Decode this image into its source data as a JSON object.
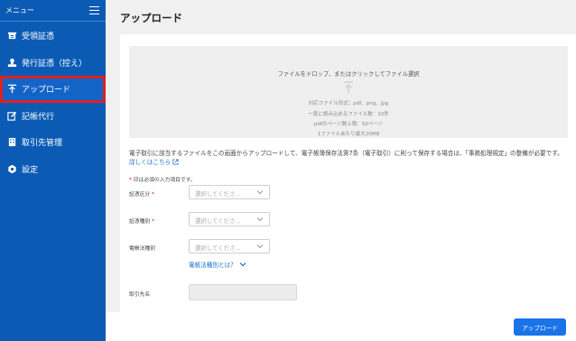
{
  "sidebar": {
    "menu_label": "メニュー",
    "items": [
      {
        "label": "受領証憑",
        "icon": "receipt-icon"
      },
      {
        "label": "発行証憑（控え）",
        "icon": "stamp-icon"
      },
      {
        "label": "アップロード",
        "icon": "upload-icon"
      },
      {
        "label": "記帳代行",
        "icon": "edit-icon"
      },
      {
        "label": "取引先管理",
        "icon": "building-icon"
      },
      {
        "label": "設定",
        "icon": "gear-icon"
      }
    ],
    "active_index": 2,
    "highlight_color": "#e02020"
  },
  "main": {
    "title": "アップロード",
    "dropzone": {
      "main_text": "ファイルをドロップ、またはクリックしてファイル選択",
      "formats": "対応ファイル形式：pdf、png、jpg",
      "max_files": "一度に読み込めるファイル数：10件",
      "max_pages": "pdfのページ数上限：50ページ",
      "max_size": "1ファイルあたり最大20MB"
    },
    "description": "電子取引に該当するファイルをこの画面からアップロードして、電子帳簿保存法第7条（電子取引）に則って保存する場合は、「事務処理規定」の整備が必要です。",
    "description_link": "詳しくはこちら",
    "required_note": "印は必須の入力項目です。",
    "fields": [
      {
        "label": "証憑区分",
        "required": true,
        "placeholder": "選択してくださ…"
      },
      {
        "label": "証憑種別",
        "required": true,
        "placeholder": "選択してくださ…"
      },
      {
        "label": "電帳法種別",
        "required": false,
        "placeholder": "選択してくださ…"
      }
    ],
    "ebook_link": "電帳法種別とは？",
    "partner_label": "取引先名",
    "upload_button": "アップロード",
    "accent_color": "#1a73e8",
    "sidebar_color": "#0b5bb5"
  }
}
